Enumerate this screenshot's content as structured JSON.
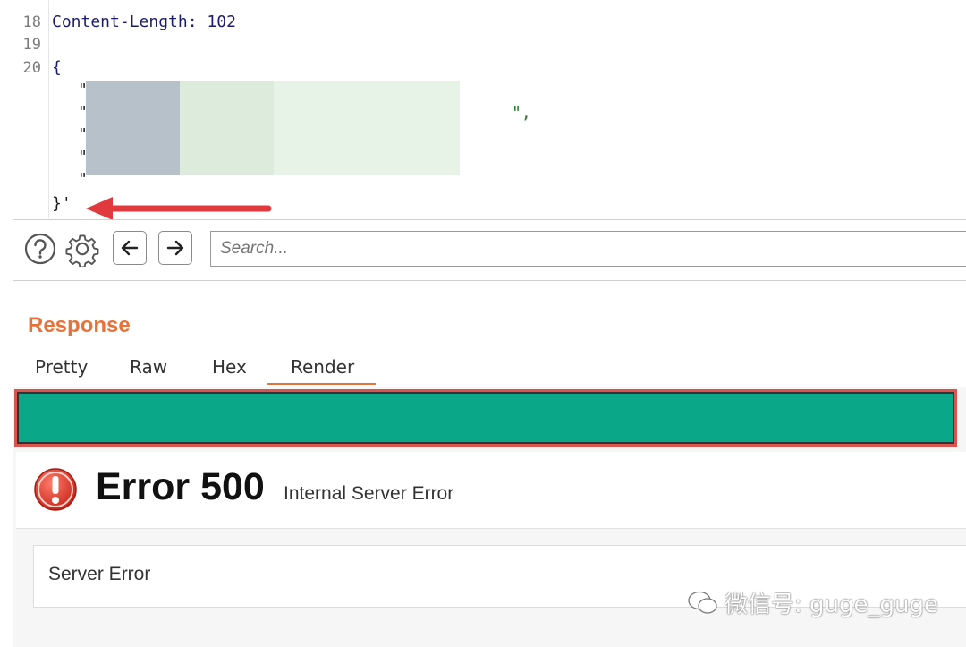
{
  "editor": {
    "lines": [
      {
        "num": "18",
        "text": "Content-Length: 102"
      },
      {
        "num": "19",
        "text": ""
      },
      {
        "num": "20",
        "text": "{"
      }
    ],
    "quote_char": "\"",
    "line2_tail": "\",",
    "closing": "}'"
  },
  "toolbar": {
    "help_icon": "help-circle-icon",
    "settings_icon": "gear-icon",
    "back_icon": "arrow-left-icon",
    "forward_icon": "arrow-right-icon",
    "search_placeholder": "Search..."
  },
  "response": {
    "title": "Response",
    "tabs": [
      "Pretty",
      "Raw",
      "Hex",
      "Render"
    ],
    "active_tab": "Render",
    "render": {
      "banner_color": "#0aa889",
      "error_title": "Error 500",
      "error_subtitle": "Internal Server Error",
      "detail": "Server Error"
    }
  },
  "watermark": "微信号: guge_guge",
  "colors": {
    "accent": "#e8733a",
    "annotation_red": "#e0393e",
    "error_red": "#d9534f"
  }
}
